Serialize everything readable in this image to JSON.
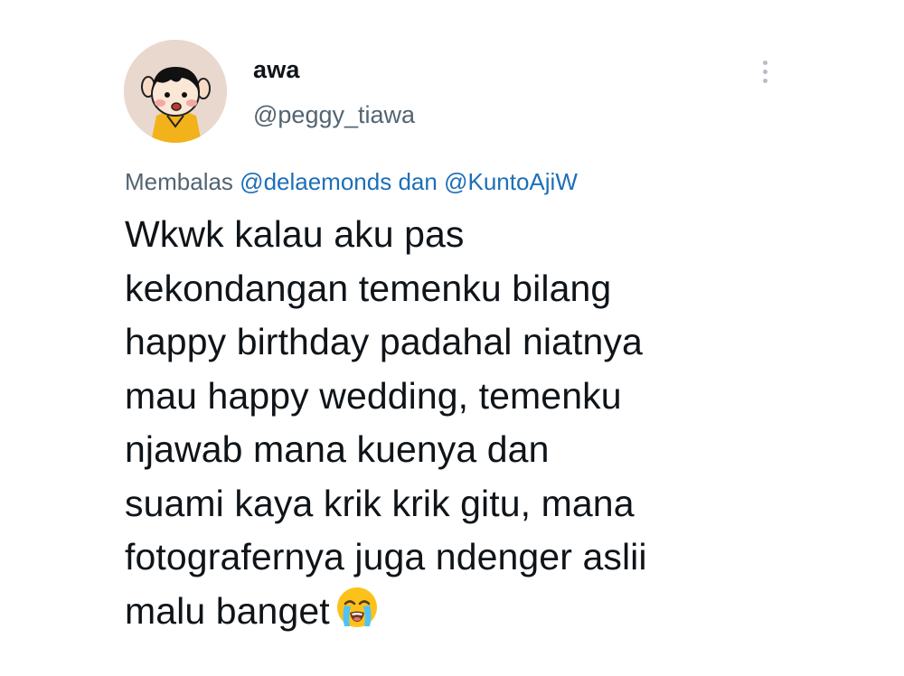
{
  "tweet": {
    "author": {
      "display_name": "awa",
      "handle": "@peggy_tiawa",
      "avatar_icon": "cartoon-avatar"
    },
    "more_icon": "more-vertical-icon",
    "reply": {
      "prefix": "Membalas",
      "mention_1": "@delaemonds",
      "connector": "dan",
      "mention_2": "@KuntoAjiW"
    },
    "text_lines": [
      "Wkwk kalau aku pas",
      "kekondangan temenku bilang",
      "happy birthday padahal niatnya",
      "mau happy wedding, temenku",
      "njawab mana kuenya dan",
      "suami kaya krik krik gitu, mana",
      "fotografernya juga ndenger aslii",
      "malu banget"
    ],
    "text_emoji": "loudly-crying-face-icon"
  },
  "colors": {
    "text": "#0f1419",
    "secondary": "#536471",
    "link": "#1d6fb8",
    "avatar_bg": "#e9d8cd"
  }
}
